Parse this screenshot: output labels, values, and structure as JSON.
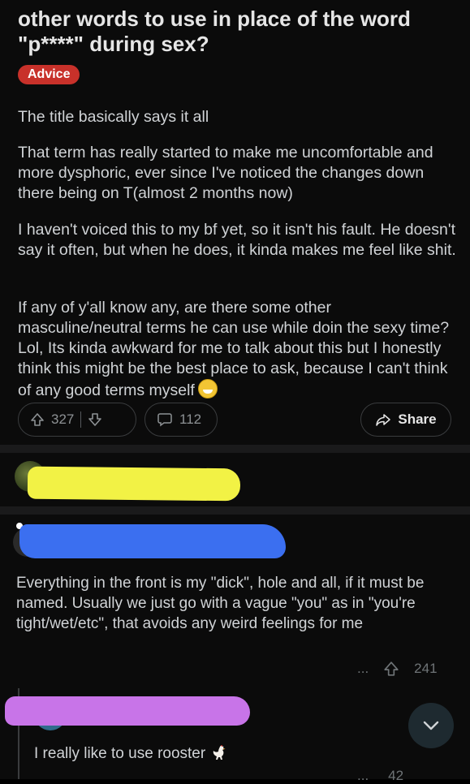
{
  "post": {
    "title": "other words to use in place of the word \"p****\" during sex?",
    "flair": "Advice",
    "paragraphs": [
      "The title basically says it all",
      "That term has really started to make me uncomfortable and more dysphoric, ever since I've noticed the changes down there being on T(almost 2 months now)",
      "I haven't voiced this to my bf yet, so it isn't his fault. He doesn't say it often, but when he does, it kinda makes me feel like shit.",
      "If any of y'all know any, are there some other masculine/neutral terms he can use while doin the sexy time? Lol, Its kinda awkward for me to talk about this but I honestly think this might be the best place to ask, because I can't think of any good terms myself"
    ],
    "upvotes": "327",
    "comments": "112",
    "share_label": "Share"
  },
  "comments": [
    {
      "text": "Everything in the front is my \"dick\", hole and all, if it must be named. Usually we just go with a vague \"you\" as in \"you're tight/wet/etc\", that avoids any weird feelings for me",
      "more": "...",
      "upvotes": "241"
    }
  ],
  "reply": {
    "text": "I really like to use rooster",
    "upvotes": "42",
    "more": "..."
  },
  "colors": {
    "flair_bg": "#c8312a",
    "redaction_yellow": "#f2f245",
    "redaction_blue": "#3b6ff0",
    "redaction_pink": "#c874e8"
  },
  "icons": [
    "upvote-icon",
    "downvote-icon",
    "comment-icon",
    "share-icon",
    "more-icon",
    "chevron-down-icon",
    "smile-sweat-emoji",
    "rooster-emoji"
  ]
}
